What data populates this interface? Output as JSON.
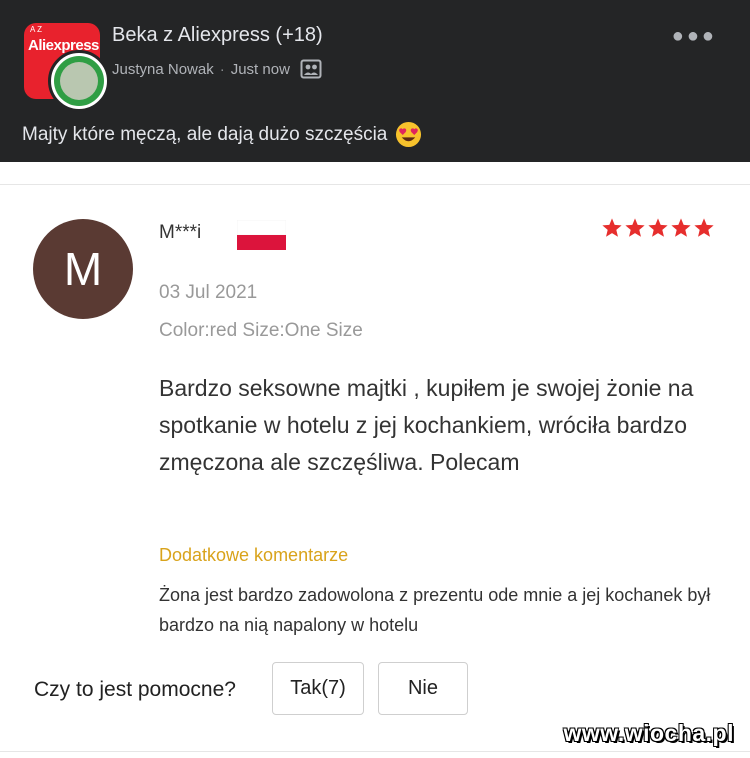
{
  "post": {
    "group_name": "Beka z Aliexpress (+18)",
    "author": "Justyna Nowak",
    "separator": "·",
    "time": "Just now",
    "text": "Majty które męczą, ale dają dużo szczęścia",
    "group_logo_text": "Aliexpress",
    "group_logo_small": "A Z",
    "more_icon": "more-horizontal-icon",
    "privacy_icon": "group-privacy-icon",
    "emoji_icon": "heart-eyes-emoji-icon"
  },
  "review": {
    "avatar_letter": "M",
    "reviewer": "M***i",
    "country_flag": "Poland",
    "rating": 5,
    "date": "03 Jul 2021",
    "variant": "Color:red Size:One Size",
    "body": "Bardzo seksowne majtki , kupiłem je swojej żonie na spotkanie w hotelu z jej kochankiem, wróciła bardzo zmęczona ale szczęśliwa. Polecam",
    "extra_heading": "Dodatkowe komentarze",
    "extra_body": "Żona jest bardzo zadowolona z prezentu ode mnie a jej kochanek był bardzo na nią napalony w hotelu",
    "helpful_label": "Czy to jest pomocne?",
    "yes_button": "Tak(7)",
    "no_button": "Nie"
  },
  "watermark": "www.wiocha.pl",
  "colors": {
    "header_bg": "#242526",
    "avatar_bg": "#5a3a33",
    "star": "#e62e2d",
    "extra_heading": "#d9a31b",
    "aliexpress_red": "#e8222d"
  }
}
